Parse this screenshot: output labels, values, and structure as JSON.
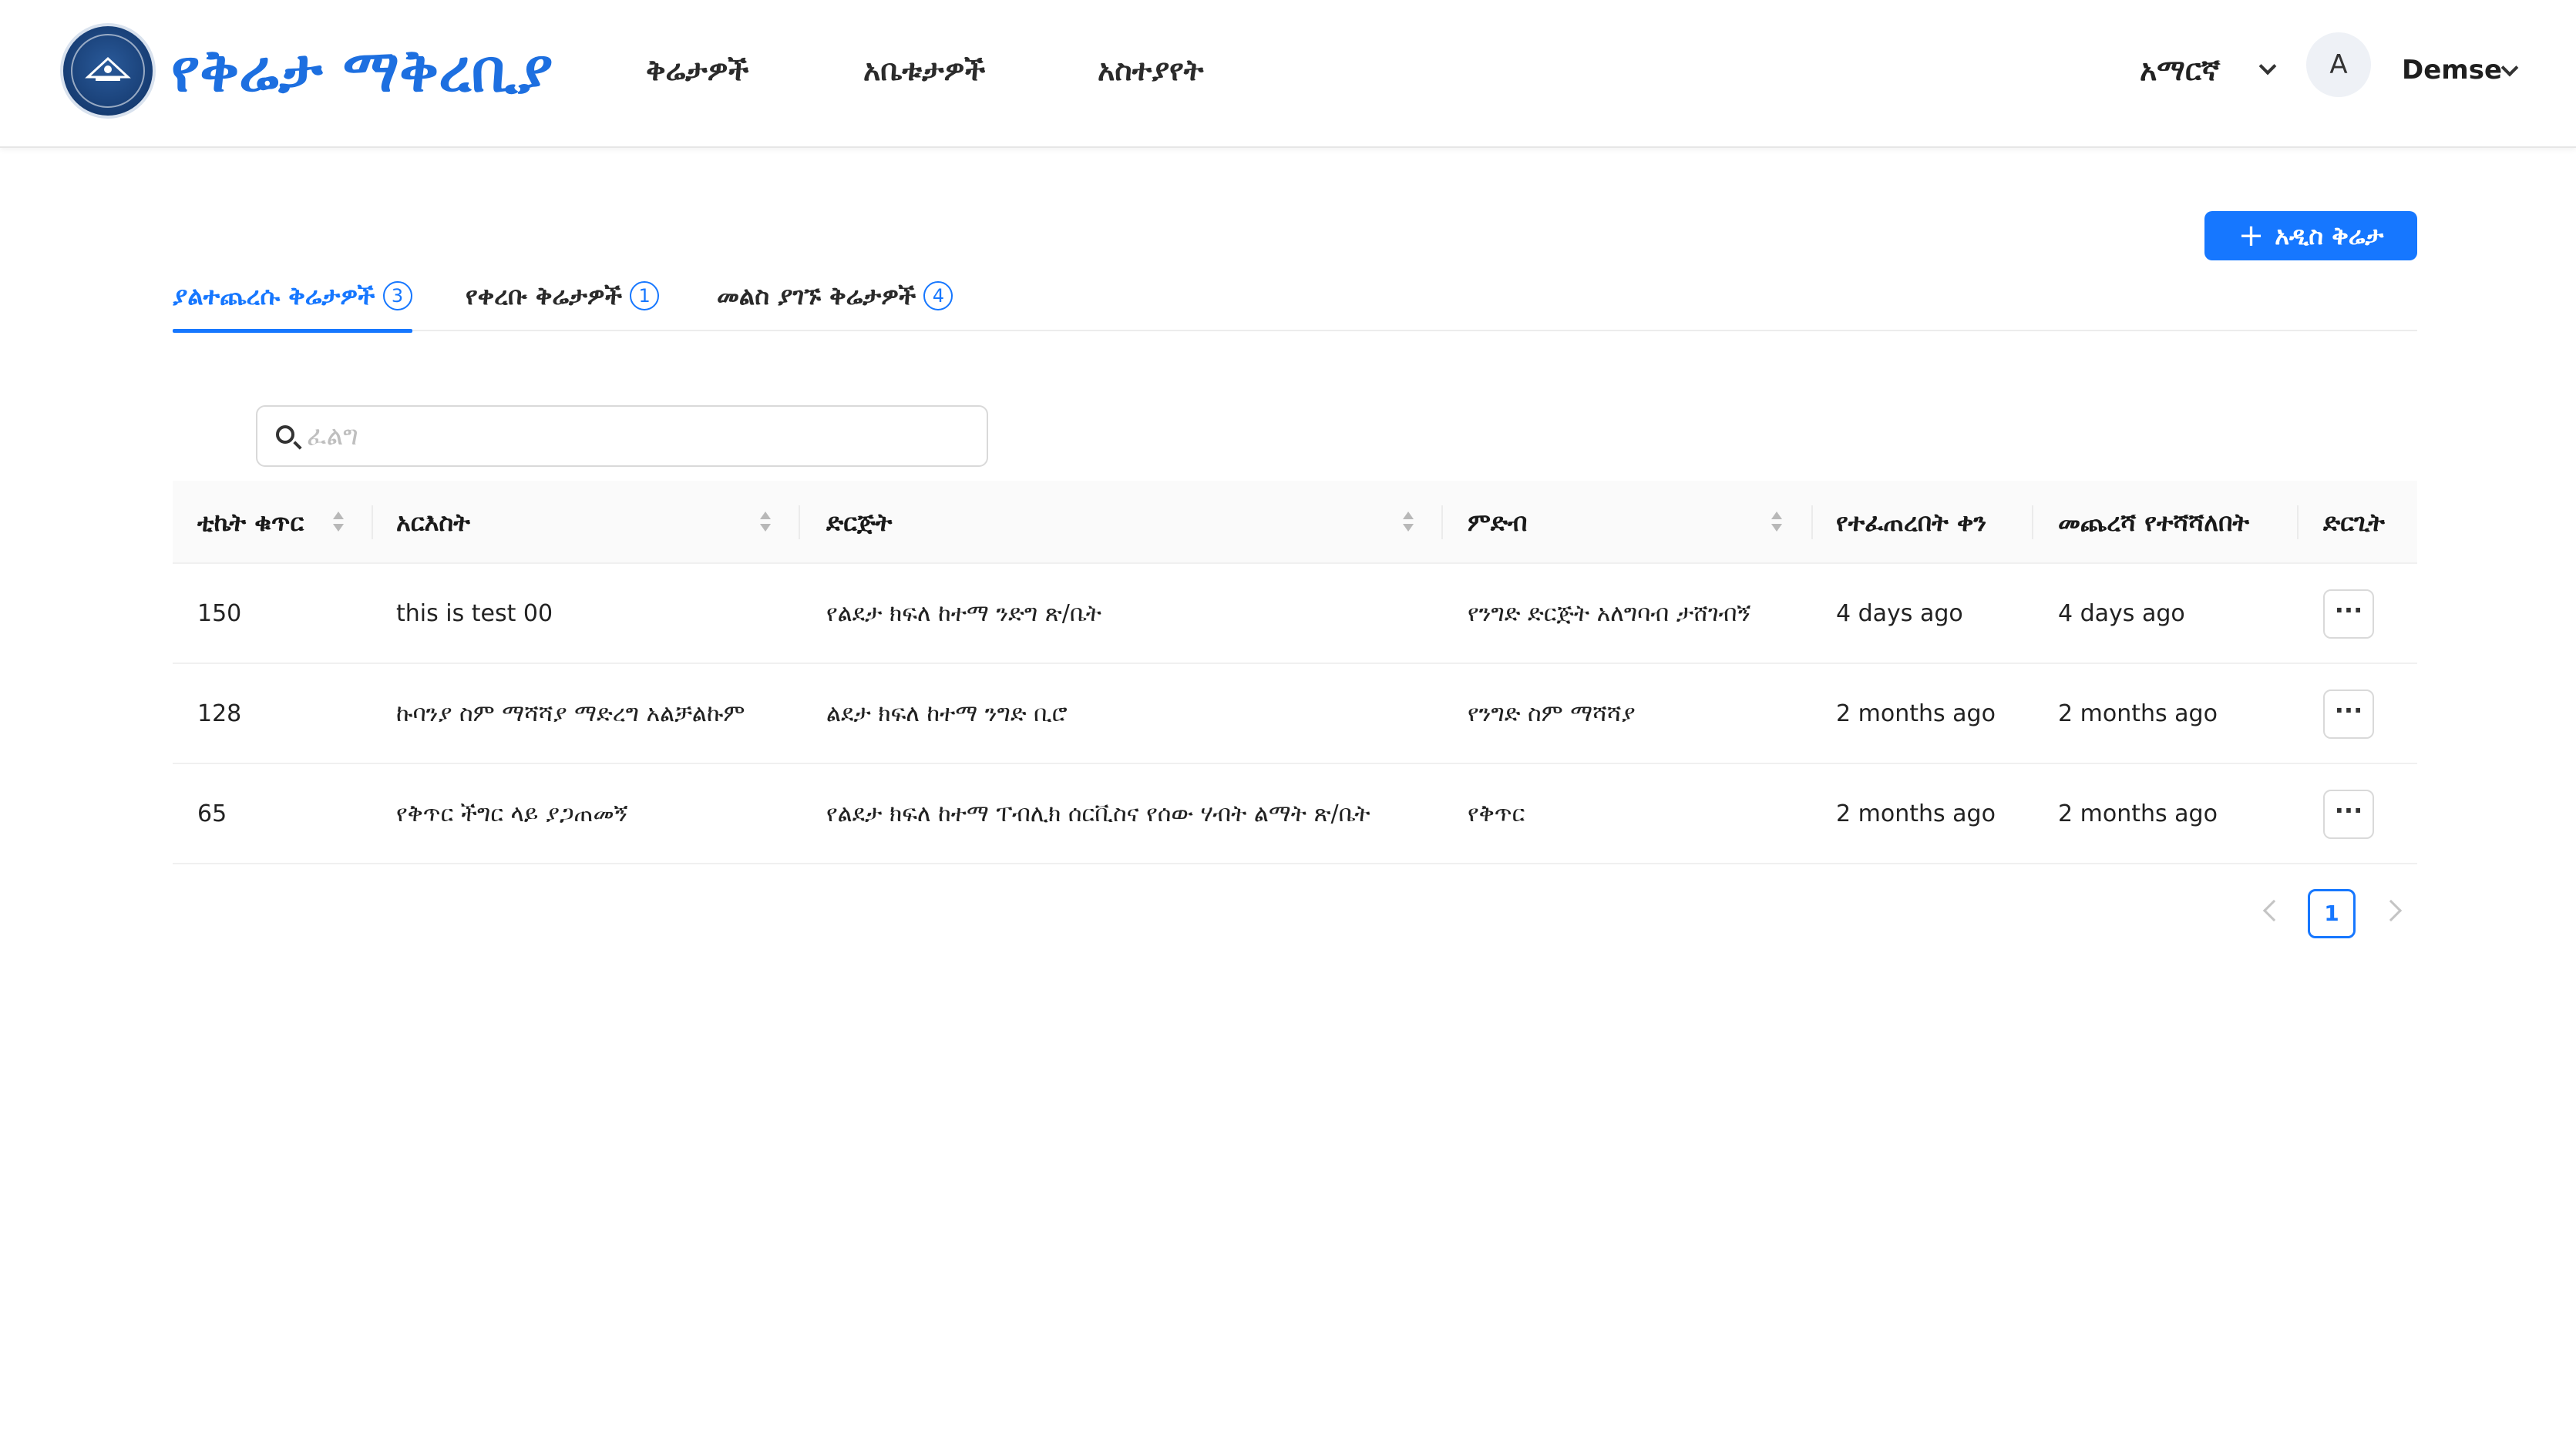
{
  "header": {
    "brand": "የቅሬታ ማቅረቢያ",
    "nav": [
      "ቅሬታዎች",
      "አቤቱታዎች",
      "አስተያየት"
    ],
    "language": "አማርኛ",
    "avatar_initial": "A",
    "user_name": "Demse"
  },
  "actions": {
    "new_label": "አዲስ ቅሬታ"
  },
  "tabs": [
    {
      "label": "ያልተጨረሱ ቅሬታዎች",
      "count": "3"
    },
    {
      "label": "የቀረቡ ቅሬታዎች",
      "count": "1"
    },
    {
      "label": "መልስ ያገኙ ቅሬታዎች",
      "count": "4"
    }
  ],
  "search": {
    "placeholder": "ፈልግ"
  },
  "table": {
    "columns": [
      "ቲኬት ቁጥር",
      "አርእስት",
      "ድርጅት",
      "ምድብ",
      "የተፈጠረበት ቀን",
      "መጨረሻ የተሻሻለበት",
      "ድርጊት"
    ],
    "rows": [
      [
        "150",
        "this is test 00",
        "የልደታ ክፍለ ከተማ ንድግ ጽ/ቤት",
        "የንግድ ድርጅት አለግባብ ታሸገብኝ",
        "4 days ago",
        "4 days ago"
      ],
      [
        "128",
        "ኩባንያ ስም ማሻሻያ ማድረግ አልቻልኩም",
        "ልደታ ክፍለ ከተማ ንግድ ቢሮ",
        "የንግድ ስም ማሻሻያ",
        "2 months ago",
        "2 months ago"
      ],
      [
        "65",
        "የቅጥር ችግር ላይ ያጋጠመኝ",
        "የልደታ ክፍለ ከተማ ፐብሊክ ሰርቪስና የሰው ሃብት ልማት ጽ/ቤት",
        "የቅጥር",
        "2 months ago",
        "2 months ago"
      ]
    ],
    "row_action_label": "···"
  },
  "pagination": {
    "current_page": "1"
  }
}
